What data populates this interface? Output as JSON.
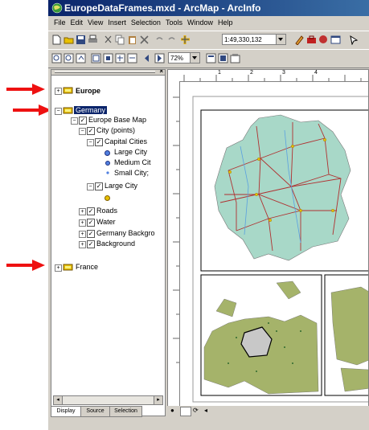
{
  "window": {
    "title": "EuropeDataFrames.mxd - ArcMap - ArcInfo"
  },
  "menubar": {
    "items": [
      "File",
      "Edit",
      "View",
      "Insert",
      "Selection",
      "Tools",
      "Window",
      "Help"
    ]
  },
  "toolbar": {
    "scale_value": "1:49,330,132",
    "zoom_percent": "72%"
  },
  "toc": {
    "tree": {
      "europe": "Europe",
      "germany": "Germany",
      "europe_base_map": "Europe Base Map",
      "city_points": "City (points)",
      "capital_cities": "Capital Cities",
      "large_city": "Large City",
      "medium_city": "Medium Cit",
      "small_city": "Small City;",
      "large_city_layer": "Large City",
      "roads": "Roads",
      "water": "Water",
      "germany_background": "Germany Backgro",
      "background": "Background",
      "france": "France"
    },
    "tabs": [
      "Display",
      "Source",
      "Selection"
    ]
  },
  "ruler": {
    "marks": [
      "1",
      "2",
      "3",
      "4"
    ]
  },
  "colors": {
    "annotation_arrow": "#ee1111",
    "title_bar": "#0a246a",
    "land": "#a8d8c8",
    "roads": "#b03030",
    "europe_land": "#a5b36a",
    "data_frame_icon": "#e8c000"
  }
}
